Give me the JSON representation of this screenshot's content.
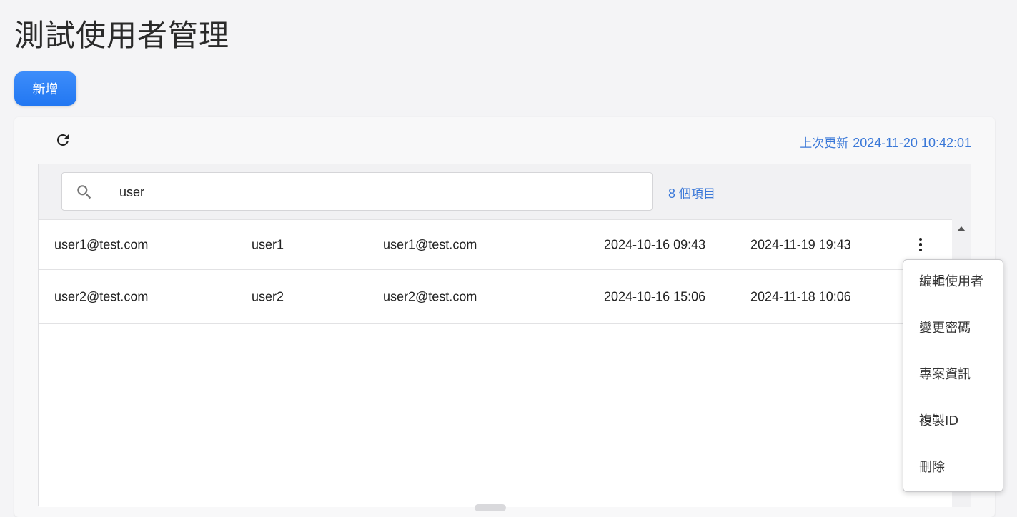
{
  "page": {
    "title": "測試使用者管理"
  },
  "toolbar": {
    "add_label": "新增"
  },
  "status": {
    "last_update_label": "上次更新",
    "last_update_time": "2024-11-20 10:42:01"
  },
  "search": {
    "value": "user",
    "icon": "search-icon"
  },
  "results": {
    "count": "8",
    "count_unit": "個項目"
  },
  "rows": [
    {
      "account": "user1@test.com",
      "name": "user1",
      "email": "user1@test.com",
      "created": "2024-10-16 09:43",
      "last_login": "2024-11-19 19:43"
    },
    {
      "account": "user2@test.com",
      "name": "user2",
      "email": "user2@test.com",
      "created": "2024-10-16 15:06",
      "last_login": "2024-11-18 10:06"
    }
  ],
  "context_menu": {
    "items": [
      {
        "label": "編輯使用者"
      },
      {
        "label": "變更密碼"
      },
      {
        "label": "專案資訊"
      },
      {
        "label": "複製ID"
      },
      {
        "label": "刪除"
      }
    ]
  },
  "colors": {
    "accent": "#2277f2",
    "link": "#3a78d8",
    "background": "#f4f4f6"
  }
}
